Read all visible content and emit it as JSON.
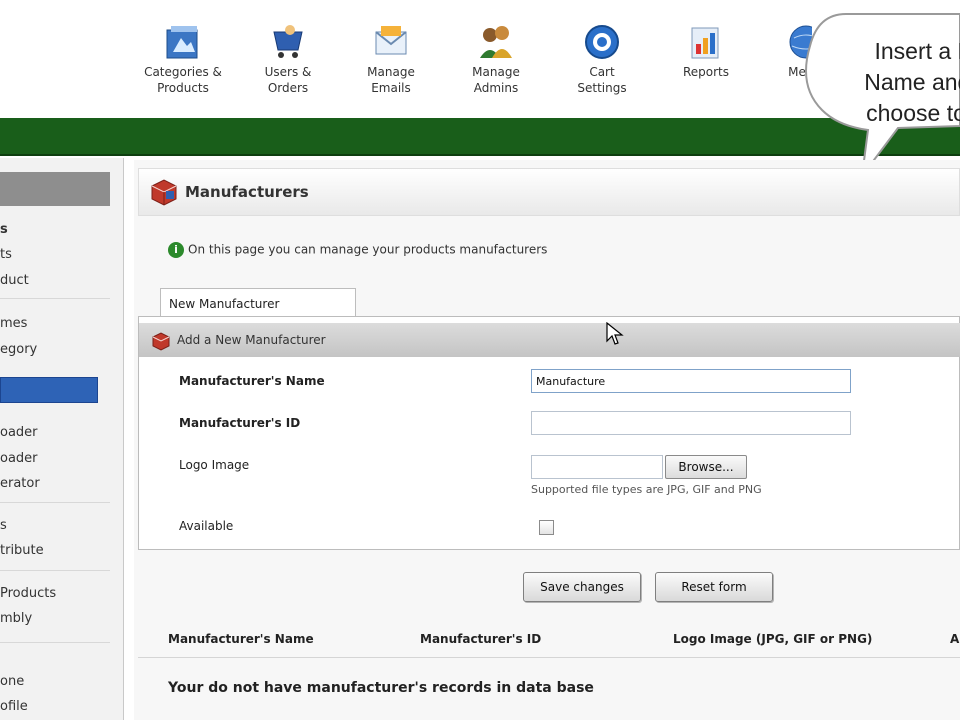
{
  "toolbar": {
    "items": [
      {
        "label": "Categories &\nProducts",
        "icon": "categories-products-icon"
      },
      {
        "label": "Users &\nOrders",
        "icon": "users-orders-icon"
      },
      {
        "label": "Manage\nEmails",
        "icon": "manage-emails-icon"
      },
      {
        "label": "Manage\nAdmins",
        "icon": "manage-admins-icon"
      },
      {
        "label": "Cart\nSettings",
        "icon": "cart-settings-icon"
      },
      {
        "label": "Reports",
        "icon": "reports-icon"
      },
      {
        "label": "Me",
        "icon": "globe-icon"
      }
    ]
  },
  "callout": {
    "text": "Insert a Ma\nName and ID\nchoose to ad"
  },
  "sidebar": {
    "items": [
      {
        "label": "s",
        "style": "bold"
      },
      {
        "label": "ts",
        "style": "normal"
      },
      {
        "label": "duct",
        "style": "normal"
      },
      {
        "label": "mes",
        "style": "normal"
      },
      {
        "label": "egory",
        "style": "normal"
      },
      {
        "label": "",
        "style": "selected"
      },
      {
        "label": "oader",
        "style": "normal"
      },
      {
        "label": "oader",
        "style": "normal"
      },
      {
        "label": "erator",
        "style": "normal"
      },
      {
        "label": "s",
        "style": "normal"
      },
      {
        "label": "tribute",
        "style": "normal"
      },
      {
        "label": "Products",
        "style": "normal"
      },
      {
        "label": "mbly",
        "style": "normal"
      },
      {
        "label": "one",
        "style": "normal"
      },
      {
        "label": "ofile",
        "style": "normal"
      }
    ]
  },
  "page": {
    "title": "Manufacturers",
    "info": "On this page you can manage your products manufacturers"
  },
  "tab": {
    "label": "New Manufacturer"
  },
  "form": {
    "header": "Add a New Manufacturer",
    "name_label": "Manufacturer's Name",
    "name_value": "Manufacture",
    "id_label": "Manufacturer's ID",
    "id_value": "",
    "logo_label": "Logo Image",
    "browse_label": "Browse...",
    "logo_hint": "Supported file types are JPG, GIF and PNG",
    "available_label": "Available",
    "available_checked": false
  },
  "actions": {
    "save_label": "Save changes",
    "reset_label": "Reset form"
  },
  "table": {
    "columns": [
      "Manufacturer's Name",
      "Manufacturer's ID",
      "Logo Image (JPG, GIF or PNG)",
      "A"
    ],
    "empty_message": "Your do not have manufacturer's records in data base"
  },
  "colors": {
    "header_green": "#195e1a",
    "selection_blue": "#2e63b6",
    "panel_gray": "#c4c4c4"
  }
}
